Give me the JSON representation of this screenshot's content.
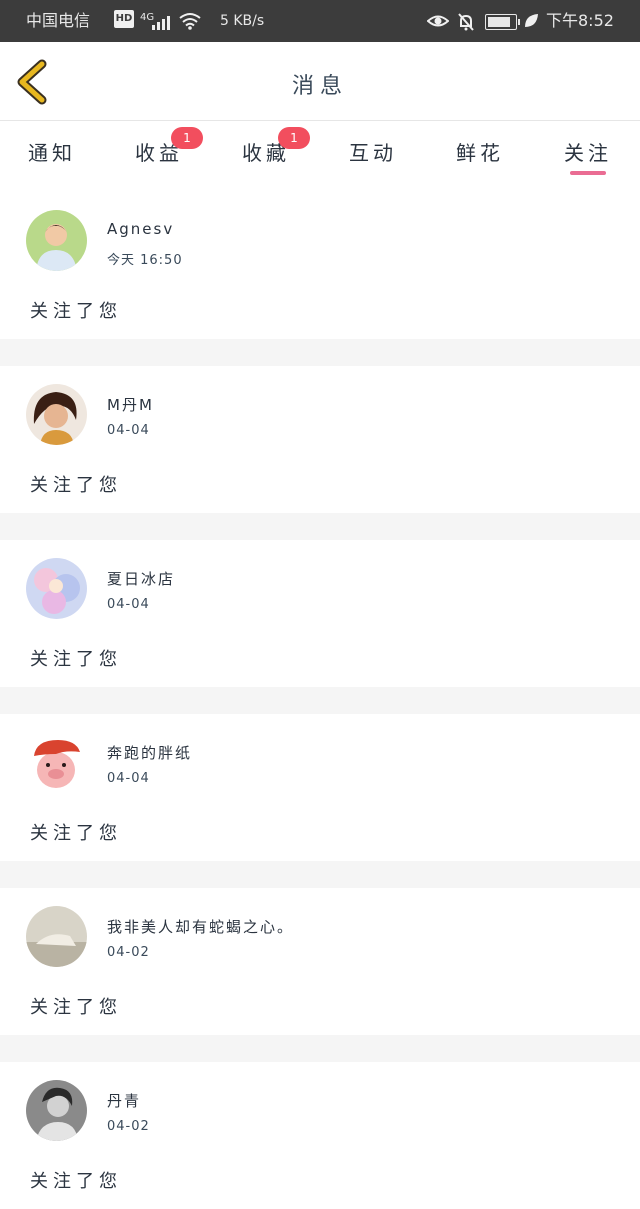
{
  "status_bar": {
    "carrier": "中国电信",
    "hd": "HD",
    "network": "4G",
    "speed": "5 KB/s",
    "battery_level": 0.9,
    "time": "下午8:52"
  },
  "header": {
    "title": "消息"
  },
  "tabs": [
    {
      "label": "通知",
      "badge": null,
      "active": false
    },
    {
      "label": "收益",
      "badge": "1",
      "active": false
    },
    {
      "label": "收藏",
      "badge": "1",
      "active": false
    },
    {
      "label": "互动",
      "badge": null,
      "active": false
    },
    {
      "label": "鲜花",
      "badge": null,
      "active": false
    },
    {
      "label": "关注",
      "badge": null,
      "active": true
    }
  ],
  "messages": [
    {
      "name": "Agnesv",
      "time": "今天 16:50",
      "action": "关注了您"
    },
    {
      "name": "M丹M",
      "time": "04-04",
      "action": "关注了您"
    },
    {
      "name": "夏日冰店",
      "time": "04-04",
      "action": "关注了您"
    },
    {
      "name": "奔跑的胖纸",
      "time": "04-04",
      "action": "关注了您"
    },
    {
      "name": "我非美人却有蛇蝎之心。",
      "time": "04-02",
      "action": "关注了您"
    },
    {
      "name": "丹青",
      "time": "04-02",
      "action": "关注了您"
    }
  ],
  "colors": {
    "accent": "#ea6c93",
    "badge": "#f24e5e",
    "back_arrow": "#e8b820"
  }
}
